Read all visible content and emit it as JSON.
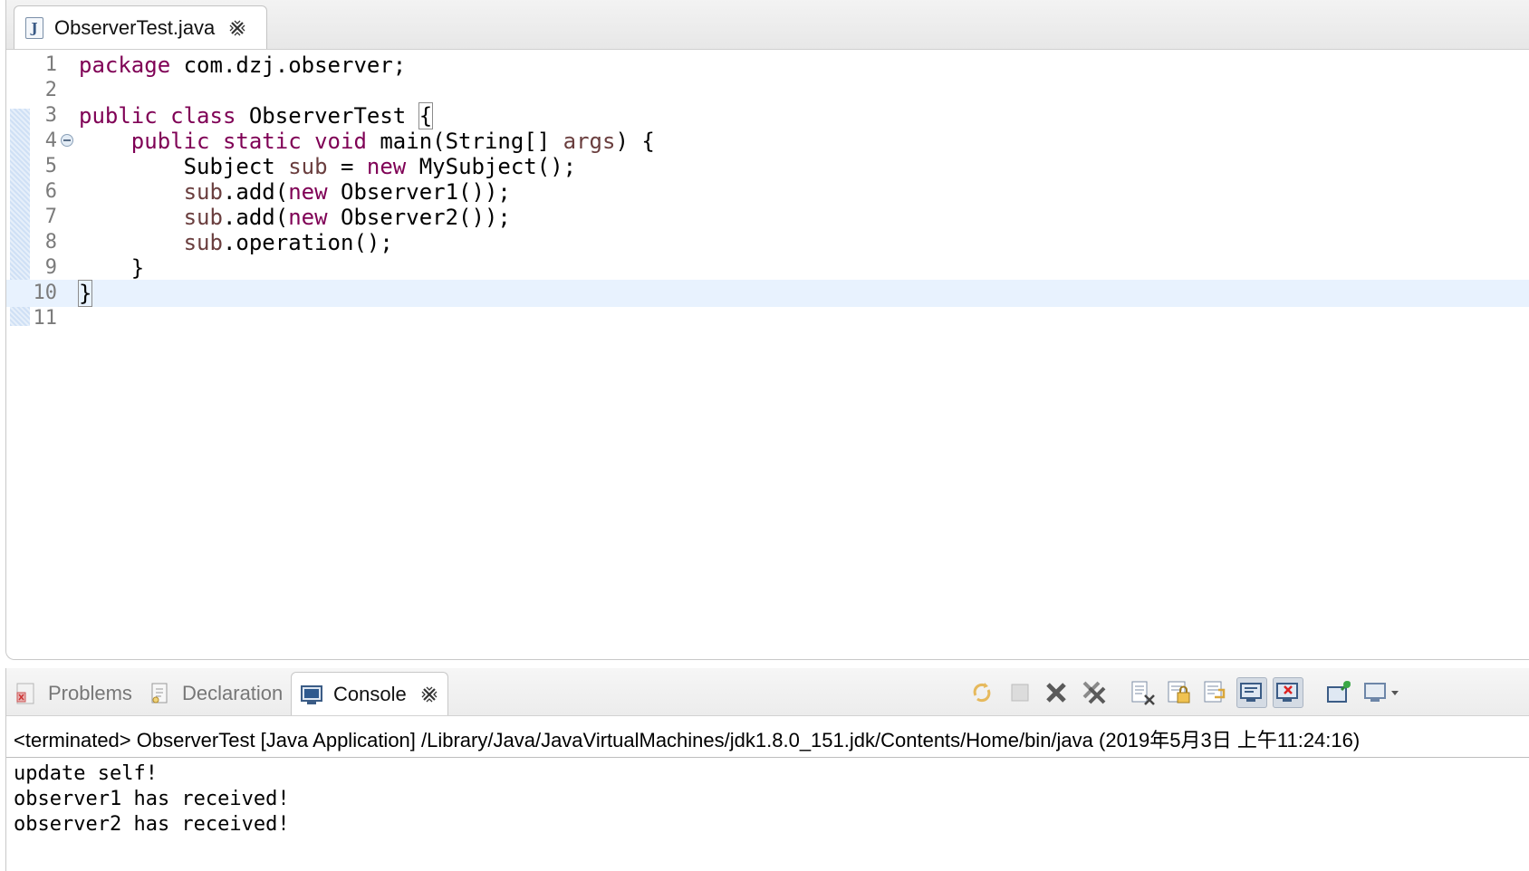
{
  "editor": {
    "tab": {
      "title": "ObserverTest.java",
      "icon": "java-file-icon"
    },
    "lines": [
      {
        "n": "1",
        "tokens": [
          [
            "kw",
            "package"
          ],
          [
            "t",
            " com.dzj.observer;"
          ]
        ]
      },
      {
        "n": "2",
        "tokens": []
      },
      {
        "n": "3",
        "tokens": [
          [
            "kw",
            "public"
          ],
          [
            "t",
            " "
          ],
          [
            "kw",
            "class"
          ],
          [
            "t",
            " ObserverTest "
          ],
          [
            "box",
            "{"
          ]
        ]
      },
      {
        "n": "4",
        "fold": true,
        "tokens": [
          [
            "t",
            "    "
          ],
          [
            "kw",
            "public"
          ],
          [
            "t",
            " "
          ],
          [
            "kw",
            "static"
          ],
          [
            "t",
            " "
          ],
          [
            "kw",
            "void"
          ],
          [
            "t",
            " main(String[] "
          ],
          [
            "var",
            "args"
          ],
          [
            "t",
            ") {"
          ]
        ]
      },
      {
        "n": "5",
        "tokens": [
          [
            "t",
            "        Subject "
          ],
          [
            "var",
            "sub"
          ],
          [
            "t",
            " = "
          ],
          [
            "kw",
            "new"
          ],
          [
            "t",
            " MySubject();"
          ]
        ]
      },
      {
        "n": "6",
        "tokens": [
          [
            "t",
            "        "
          ],
          [
            "var",
            "sub"
          ],
          [
            "t",
            ".add("
          ],
          [
            "kw",
            "new"
          ],
          [
            "t",
            " Observer1());"
          ]
        ]
      },
      {
        "n": "7",
        "tokens": [
          [
            "t",
            "        "
          ],
          [
            "var",
            "sub"
          ],
          [
            "t",
            ".add("
          ],
          [
            "kw",
            "new"
          ],
          [
            "t",
            " Observer2());"
          ]
        ]
      },
      {
        "n": "8",
        "tokens": [
          [
            "t",
            "        "
          ],
          [
            "var",
            "sub"
          ],
          [
            "t",
            ".operation();"
          ]
        ]
      },
      {
        "n": "9",
        "tokens": [
          [
            "t",
            "    }"
          ]
        ]
      },
      {
        "n": "10",
        "current": true,
        "tokens": [
          [
            "box",
            "}"
          ]
        ]
      },
      {
        "n": "11",
        "tokens": []
      }
    ]
  },
  "views": {
    "tabs": [
      {
        "label": "Problems",
        "icon": "problems-icon"
      },
      {
        "label": "Declaration",
        "icon": "declaration-icon"
      },
      {
        "label": "Console",
        "icon": "console-icon",
        "active": true
      }
    ],
    "toolbar_icons": [
      "pin-sync-icon",
      "terminate-icon",
      "remove-launch-icon",
      "remove-all-terminated-icon",
      "clear-console-icon",
      "scroll-lock-icon",
      "word-wrap-icon",
      "show-on-stdout-icon",
      "show-on-stderr-icon",
      "pin-console-icon",
      "display-console-icon"
    ]
  },
  "console": {
    "header": "<terminated> ObserverTest [Java Application] /Library/Java/JavaVirtualMachines/jdk1.8.0_151.jdk/Contents/Home/bin/java (2019年5月3日 上午11:24:16)",
    "output": [
      "update self!",
      "observer1 has received!",
      "observer2 has received!"
    ]
  },
  "colors": {
    "keyword": "#7f0055",
    "variable": "#6a3e3e",
    "current_line": "#e8f2fe"
  }
}
